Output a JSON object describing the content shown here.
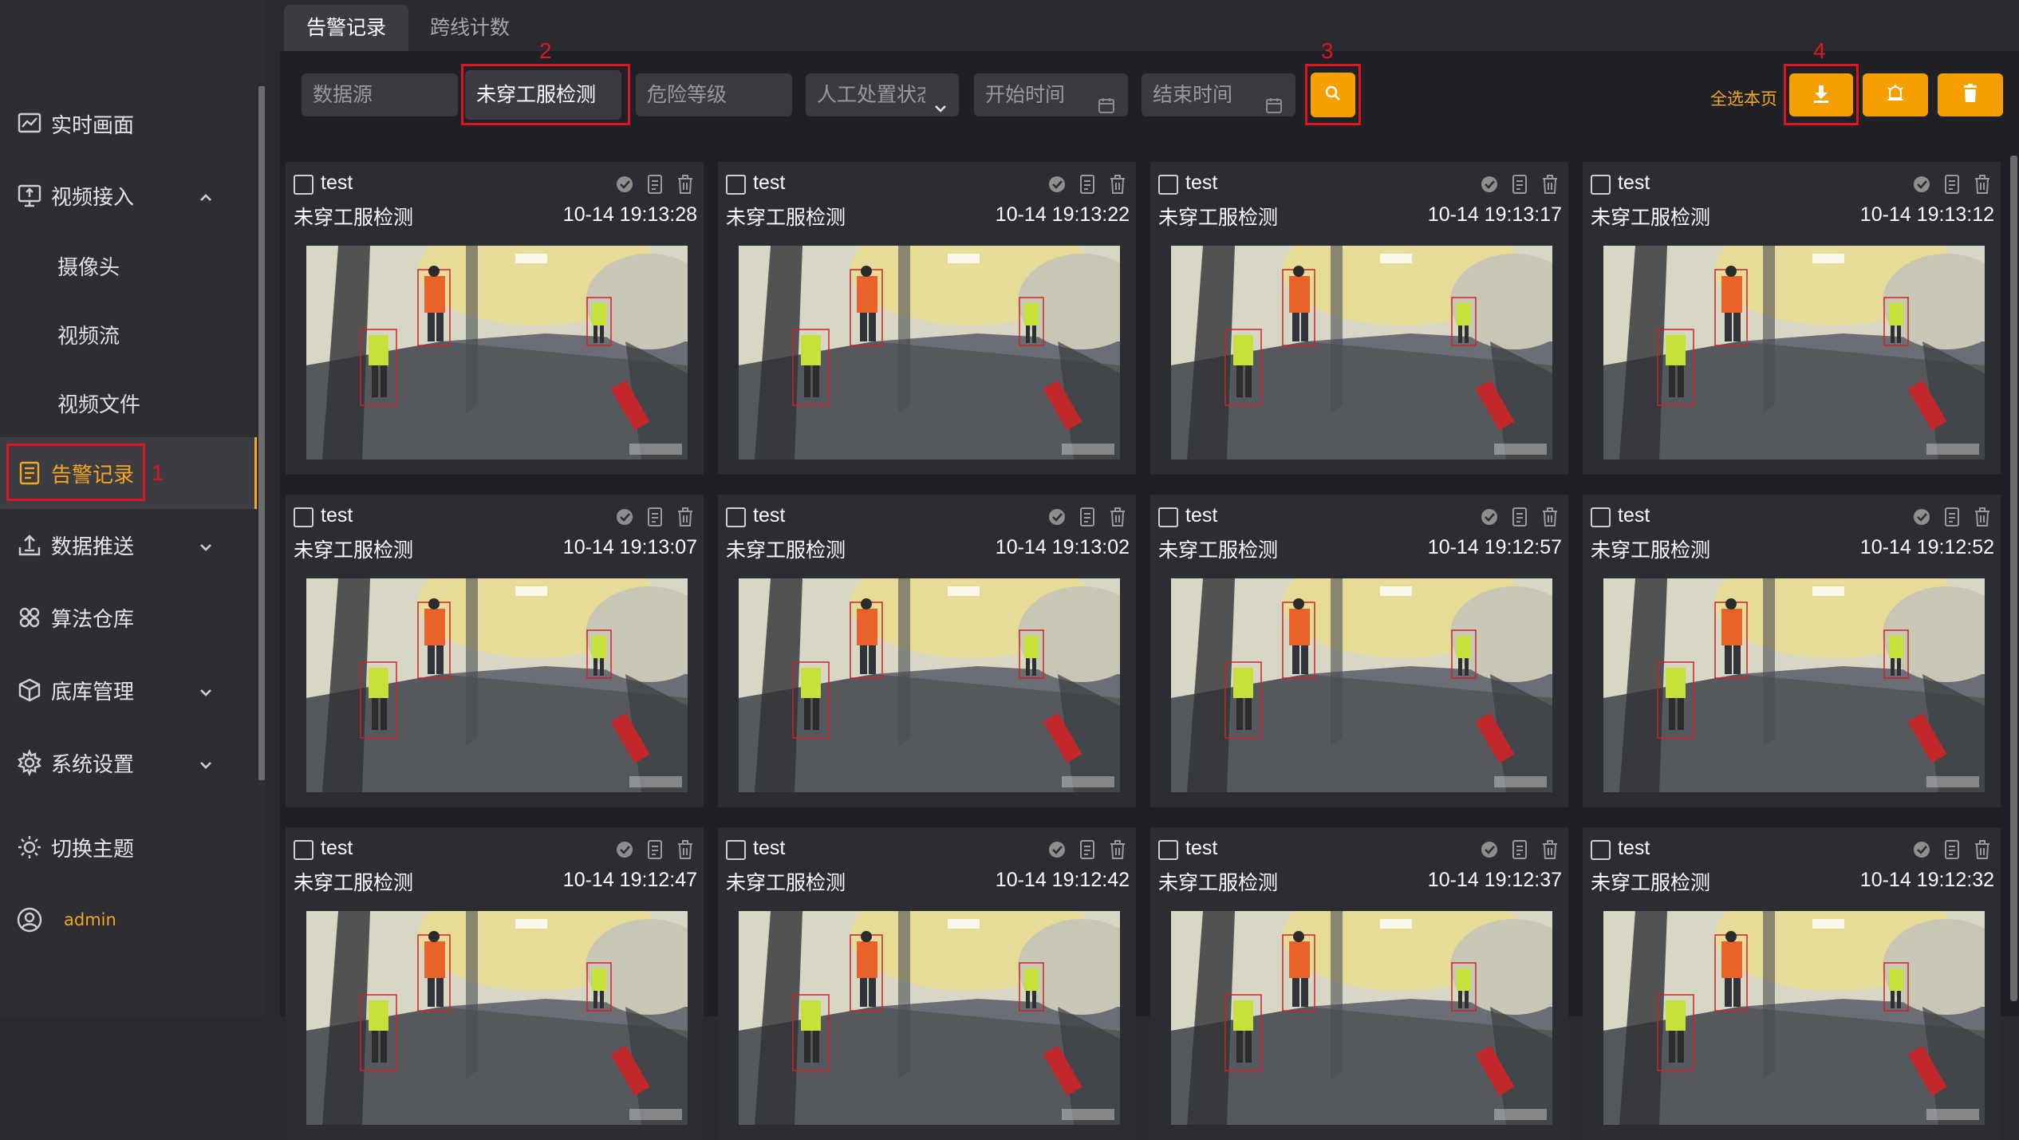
{
  "sidebar": {
    "items": [
      {
        "label": "实时画面",
        "icon": "line-chart-icon"
      },
      {
        "label": "视频接入",
        "icon": "monitor-upload-icon",
        "expanded": true
      },
      {
        "label": "告警记录",
        "icon": "document-list-icon",
        "active": true
      },
      {
        "label": "数据推送",
        "icon": "upload-tray-icon"
      },
      {
        "label": "算法仓库",
        "icon": "algorithm-nodes-icon"
      },
      {
        "label": "底库管理",
        "icon": "cube-icon"
      },
      {
        "label": "系统设置",
        "icon": "gear-icon"
      }
    ],
    "sub_items": [
      "摄像头",
      "视频流",
      "视频文件"
    ],
    "theme_label": "切换主题",
    "user_label": "admin"
  },
  "annotations": {
    "n1": "1",
    "n2": "2",
    "n3": "3",
    "n4": "4"
  },
  "tabs": [
    {
      "label": "告警记录",
      "active": true
    },
    {
      "label": "跨线计数",
      "active": false
    }
  ],
  "filters": {
    "source_placeholder": "数据源",
    "alarm_type_value": "未穿工服检测",
    "risk_level_placeholder": "危险等级",
    "handle_status_placeholder": "人工处置状态",
    "start_time_placeholder": "开始时间",
    "end_time_placeholder": "结束时间"
  },
  "toolbar": {
    "select_all_label": "全选本页"
  },
  "colors": {
    "accent": "#f5a000",
    "annotation": "#e0141e",
    "sidebar_bg": "#2d2e33",
    "card_bg": "#2c2d32"
  },
  "cards": [
    {
      "title": "test",
      "type": "未穿工服检测",
      "time": "10-14 19:13:28"
    },
    {
      "title": "test",
      "type": "未穿工服检测",
      "time": "10-14 19:13:22"
    },
    {
      "title": "test",
      "type": "未穿工服检测",
      "time": "10-14 19:13:17"
    },
    {
      "title": "test",
      "type": "未穿工服检测",
      "time": "10-14 19:13:12"
    },
    {
      "title": "test",
      "type": "未穿工服检测",
      "time": "10-14 19:13:07"
    },
    {
      "title": "test",
      "type": "未穿工服检测",
      "time": "10-14 19:13:02"
    },
    {
      "title": "test",
      "type": "未穿工服检测",
      "time": "10-14 19:12:57"
    },
    {
      "title": "test",
      "type": "未穿工服检测",
      "time": "10-14 19:12:52"
    },
    {
      "title": "test",
      "type": "未穿工服检测",
      "time": "10-14 19:12:47"
    },
    {
      "title": "test",
      "type": "未穿工服检测",
      "time": "10-14 19:12:42"
    },
    {
      "title": "test",
      "type": "未穿工服检测",
      "time": "10-14 19:12:37"
    },
    {
      "title": "test",
      "type": "未穿工服检测",
      "time": "10-14 19:12:32"
    }
  ]
}
